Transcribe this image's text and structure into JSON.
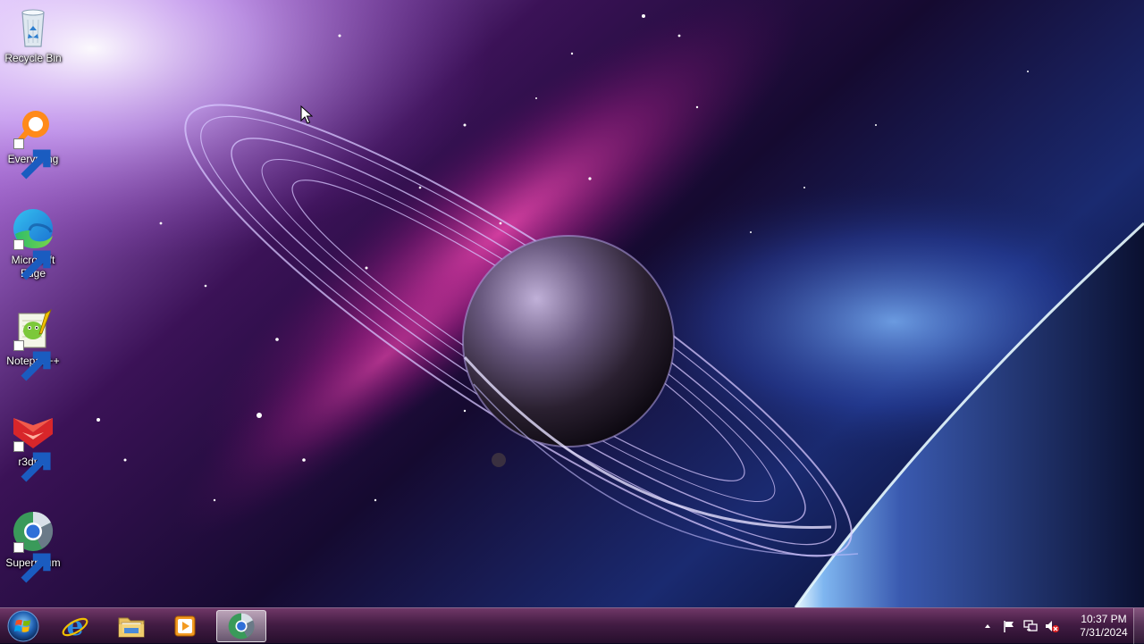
{
  "desktop": {
    "icons": [
      {
        "label": "Recycle Bin",
        "icon": "recycle-bin-icon"
      },
      {
        "label": "Everything",
        "icon": "everything-search-icon"
      },
      {
        "label": "Microsoft Edge",
        "icon": "edge-icon"
      },
      {
        "label": "Notepad++",
        "icon": "notepadpp-icon"
      },
      {
        "label": "r3dfox",
        "icon": "r3dfox-icon"
      },
      {
        "label": "Supermium",
        "icon": "supermium-icon"
      }
    ]
  },
  "taskbar": {
    "pinned": [
      {
        "icon": "internet-explorer-icon"
      },
      {
        "icon": "file-explorer-icon"
      },
      {
        "icon": "media-player-icon"
      },
      {
        "icon": "supermium-icon",
        "active": true
      }
    ],
    "tray": {
      "icons": [
        "show-hidden-icons-chevron",
        "action-center-flag-icon",
        "network-icon",
        "volume-muted-icon"
      ],
      "time": "10:37 PM",
      "date": "7/31/2024"
    }
  },
  "colors": {
    "taskbar": "#4a1f4c",
    "label_text": "#ffffff"
  }
}
